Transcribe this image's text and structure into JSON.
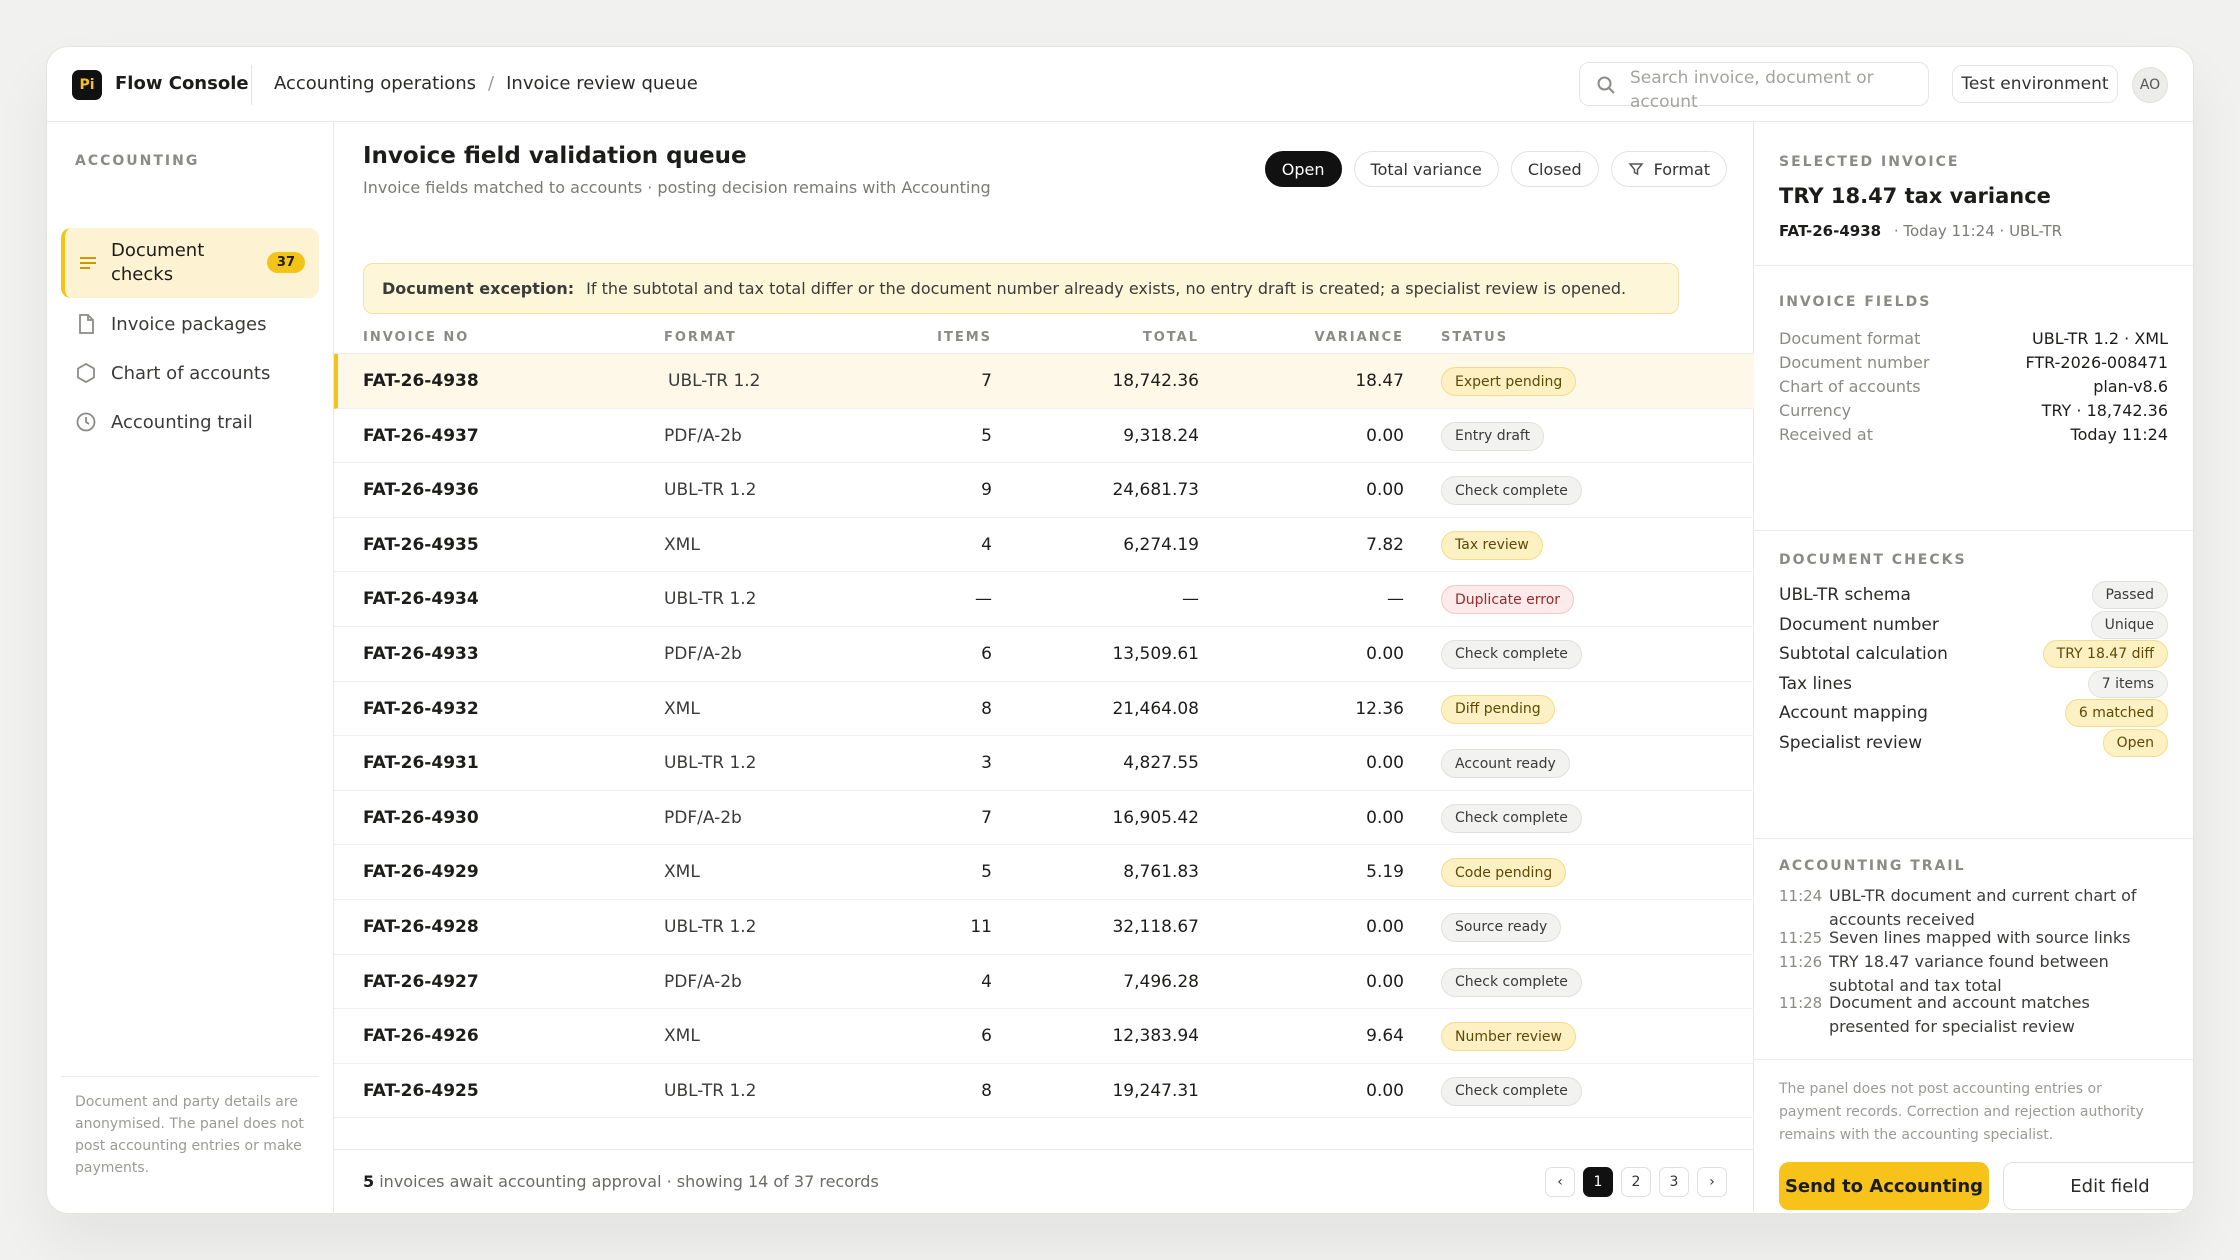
{
  "app": {
    "logo": "Pi",
    "name": "Flow Console",
    "accent": "#f7c21a"
  },
  "breadcrumb": [
    "Accounting operations",
    "Invoice review queue"
  ],
  "search": {
    "placeholder": "Search invoice, document or account"
  },
  "header": {
    "env_label": "Test environment",
    "avatar_initials": "AO"
  },
  "sidebar": {
    "section": "ACCOUNTING",
    "items": [
      {
        "label": "Document checks",
        "count": "37",
        "icon": "list-icon",
        "active": true
      },
      {
        "label": "Invoice packages",
        "icon": "document-icon"
      },
      {
        "label": "Chart of accounts",
        "icon": "hexagon-icon"
      },
      {
        "label": "Accounting trail",
        "icon": "clock-icon"
      }
    ],
    "note": "Document and party details are anonymised. The panel does not post accounting entries or make payments."
  },
  "main": {
    "title": "Invoice field validation queue",
    "subtitle": "Invoice fields matched to accounts · posting decision remains with Accounting",
    "filters": [
      "Open",
      "Total variance",
      "Closed",
      "Format"
    ],
    "alert_label": "Document exception:",
    "alert_text": "If the subtotal and tax total differ or the document number already exists, no entry draft is created; a specialist review is opened.",
    "columns": [
      "INVOICE NO",
      "FORMAT",
      "ITEMS",
      "TOTAL",
      "VARIANCE",
      "STATUS"
    ],
    "rows": [
      {
        "inv": "FAT-26-4938",
        "fmt": "UBL-TR 1.2",
        "items": "7",
        "total": "18,742.36",
        "var": "18.47",
        "status": "Expert pending",
        "tone": "yellow"
      },
      {
        "inv": "FAT-26-4937",
        "fmt": "PDF/A-2b",
        "items": "5",
        "total": "9,318.24",
        "var": "0.00",
        "status": "Entry draft",
        "tone": "gray"
      },
      {
        "inv": "FAT-26-4936",
        "fmt": "UBL-TR 1.2",
        "items": "9",
        "total": "24,681.73",
        "var": "0.00",
        "status": "Check complete",
        "tone": "gray"
      },
      {
        "inv": "FAT-26-4935",
        "fmt": "XML",
        "items": "4",
        "total": "6,274.19",
        "var": "7.82",
        "status": "Tax review",
        "tone": "yellow"
      },
      {
        "inv": "FAT-26-4934",
        "fmt": "UBL-TR 1.2",
        "items": "—",
        "total": "—",
        "var": "—",
        "status": "Duplicate error",
        "tone": "red"
      },
      {
        "inv": "FAT-26-4933",
        "fmt": "PDF/A-2b",
        "items": "6",
        "total": "13,509.61",
        "var": "0.00",
        "status": "Check complete",
        "tone": "gray"
      },
      {
        "inv": "FAT-26-4932",
        "fmt": "XML",
        "items": "8",
        "total": "21,464.08",
        "var": "12.36",
        "status": "Diff pending",
        "tone": "yellow"
      },
      {
        "inv": "FAT-26-4931",
        "fmt": "UBL-TR 1.2",
        "items": "3",
        "total": "4,827.55",
        "var": "0.00",
        "status": "Account ready",
        "tone": "gray"
      },
      {
        "inv": "FAT-26-4930",
        "fmt": "PDF/A-2b",
        "items": "7",
        "total": "16,905.42",
        "var": "0.00",
        "status": "Check complete",
        "tone": "gray"
      },
      {
        "inv": "FAT-26-4929",
        "fmt": "XML",
        "items": "5",
        "total": "8,761.83",
        "var": "5.19",
        "status": "Code pending",
        "tone": "yellow"
      },
      {
        "inv": "FAT-26-4928",
        "fmt": "UBL-TR 1.2",
        "items": "11",
        "total": "32,118.67",
        "var": "0.00",
        "status": "Source ready",
        "tone": "gray"
      },
      {
        "inv": "FAT-26-4927",
        "fmt": "PDF/A-2b",
        "items": "4",
        "total": "7,496.28",
        "var": "0.00",
        "status": "Check complete",
        "tone": "gray"
      },
      {
        "inv": "FAT-26-4926",
        "fmt": "XML",
        "items": "6",
        "total": "12,383.94",
        "var": "9.64",
        "status": "Number review",
        "tone": "yellow"
      },
      {
        "inv": "FAT-26-4925",
        "fmt": "UBL-TR 1.2",
        "items": "8",
        "total": "19,247.31",
        "var": "0.00",
        "status": "Check complete",
        "tone": "gray"
      }
    ],
    "footer_count": "5",
    "footer_text": "invoices await accounting approval · showing 14 of 37 records",
    "pager": [
      "‹",
      "1",
      "2",
      "3",
      "›"
    ]
  },
  "panel": {
    "section": "SELECTED INVOICE",
    "title": "TRY 18.47 tax variance",
    "invoice_no": "FAT-26-4938",
    "meta": "· Today 11:24 · UBL-TR",
    "fields_section": "INVOICE FIELDS",
    "fields": [
      {
        "k": "Document format",
        "v": "UBL-TR 1.2 · XML"
      },
      {
        "k": "Document number",
        "v": "FTR-2026-008471"
      },
      {
        "k": "Chart of accounts",
        "v": "plan-v8.6"
      },
      {
        "k": "Currency",
        "v": "TRY · 18,742.36"
      },
      {
        "k": "Received at",
        "v": "Today 11:24"
      }
    ],
    "checks_section": "DOCUMENT CHECKS",
    "checks": [
      {
        "k": "UBL-TR schema",
        "v": "Passed",
        "tone": "gray"
      },
      {
        "k": "Document number",
        "v": "Unique",
        "tone": "gray"
      },
      {
        "k": "Subtotal calculation",
        "v": "TRY 18.47 diff",
        "tone": "yellow"
      },
      {
        "k": "Tax lines",
        "v": "7 items",
        "tone": "gray"
      },
      {
        "k": "Account mapping",
        "v": "6 matched",
        "tone": "yellow"
      },
      {
        "k": "Specialist review",
        "v": "Open",
        "tone": "yellow"
      }
    ],
    "trail_section": "ACCOUNTING TRAIL",
    "trail": [
      {
        "t": "11:24",
        "text": "UBL-TR document and current chart of accounts received"
      },
      {
        "t": "11:25",
        "text": "Seven lines mapped with source links"
      },
      {
        "t": "11:26",
        "text": "TRY 18.47 variance found between subtotal and tax total"
      },
      {
        "t": "11:28",
        "text": "Document and account matches presented for specialist review"
      }
    ],
    "note": "The panel does not post accounting entries or payment records. Correction and rejection authority remains with the accounting specialist.",
    "primary_label": "Send to Accounting",
    "secondary_label": "Edit field"
  }
}
